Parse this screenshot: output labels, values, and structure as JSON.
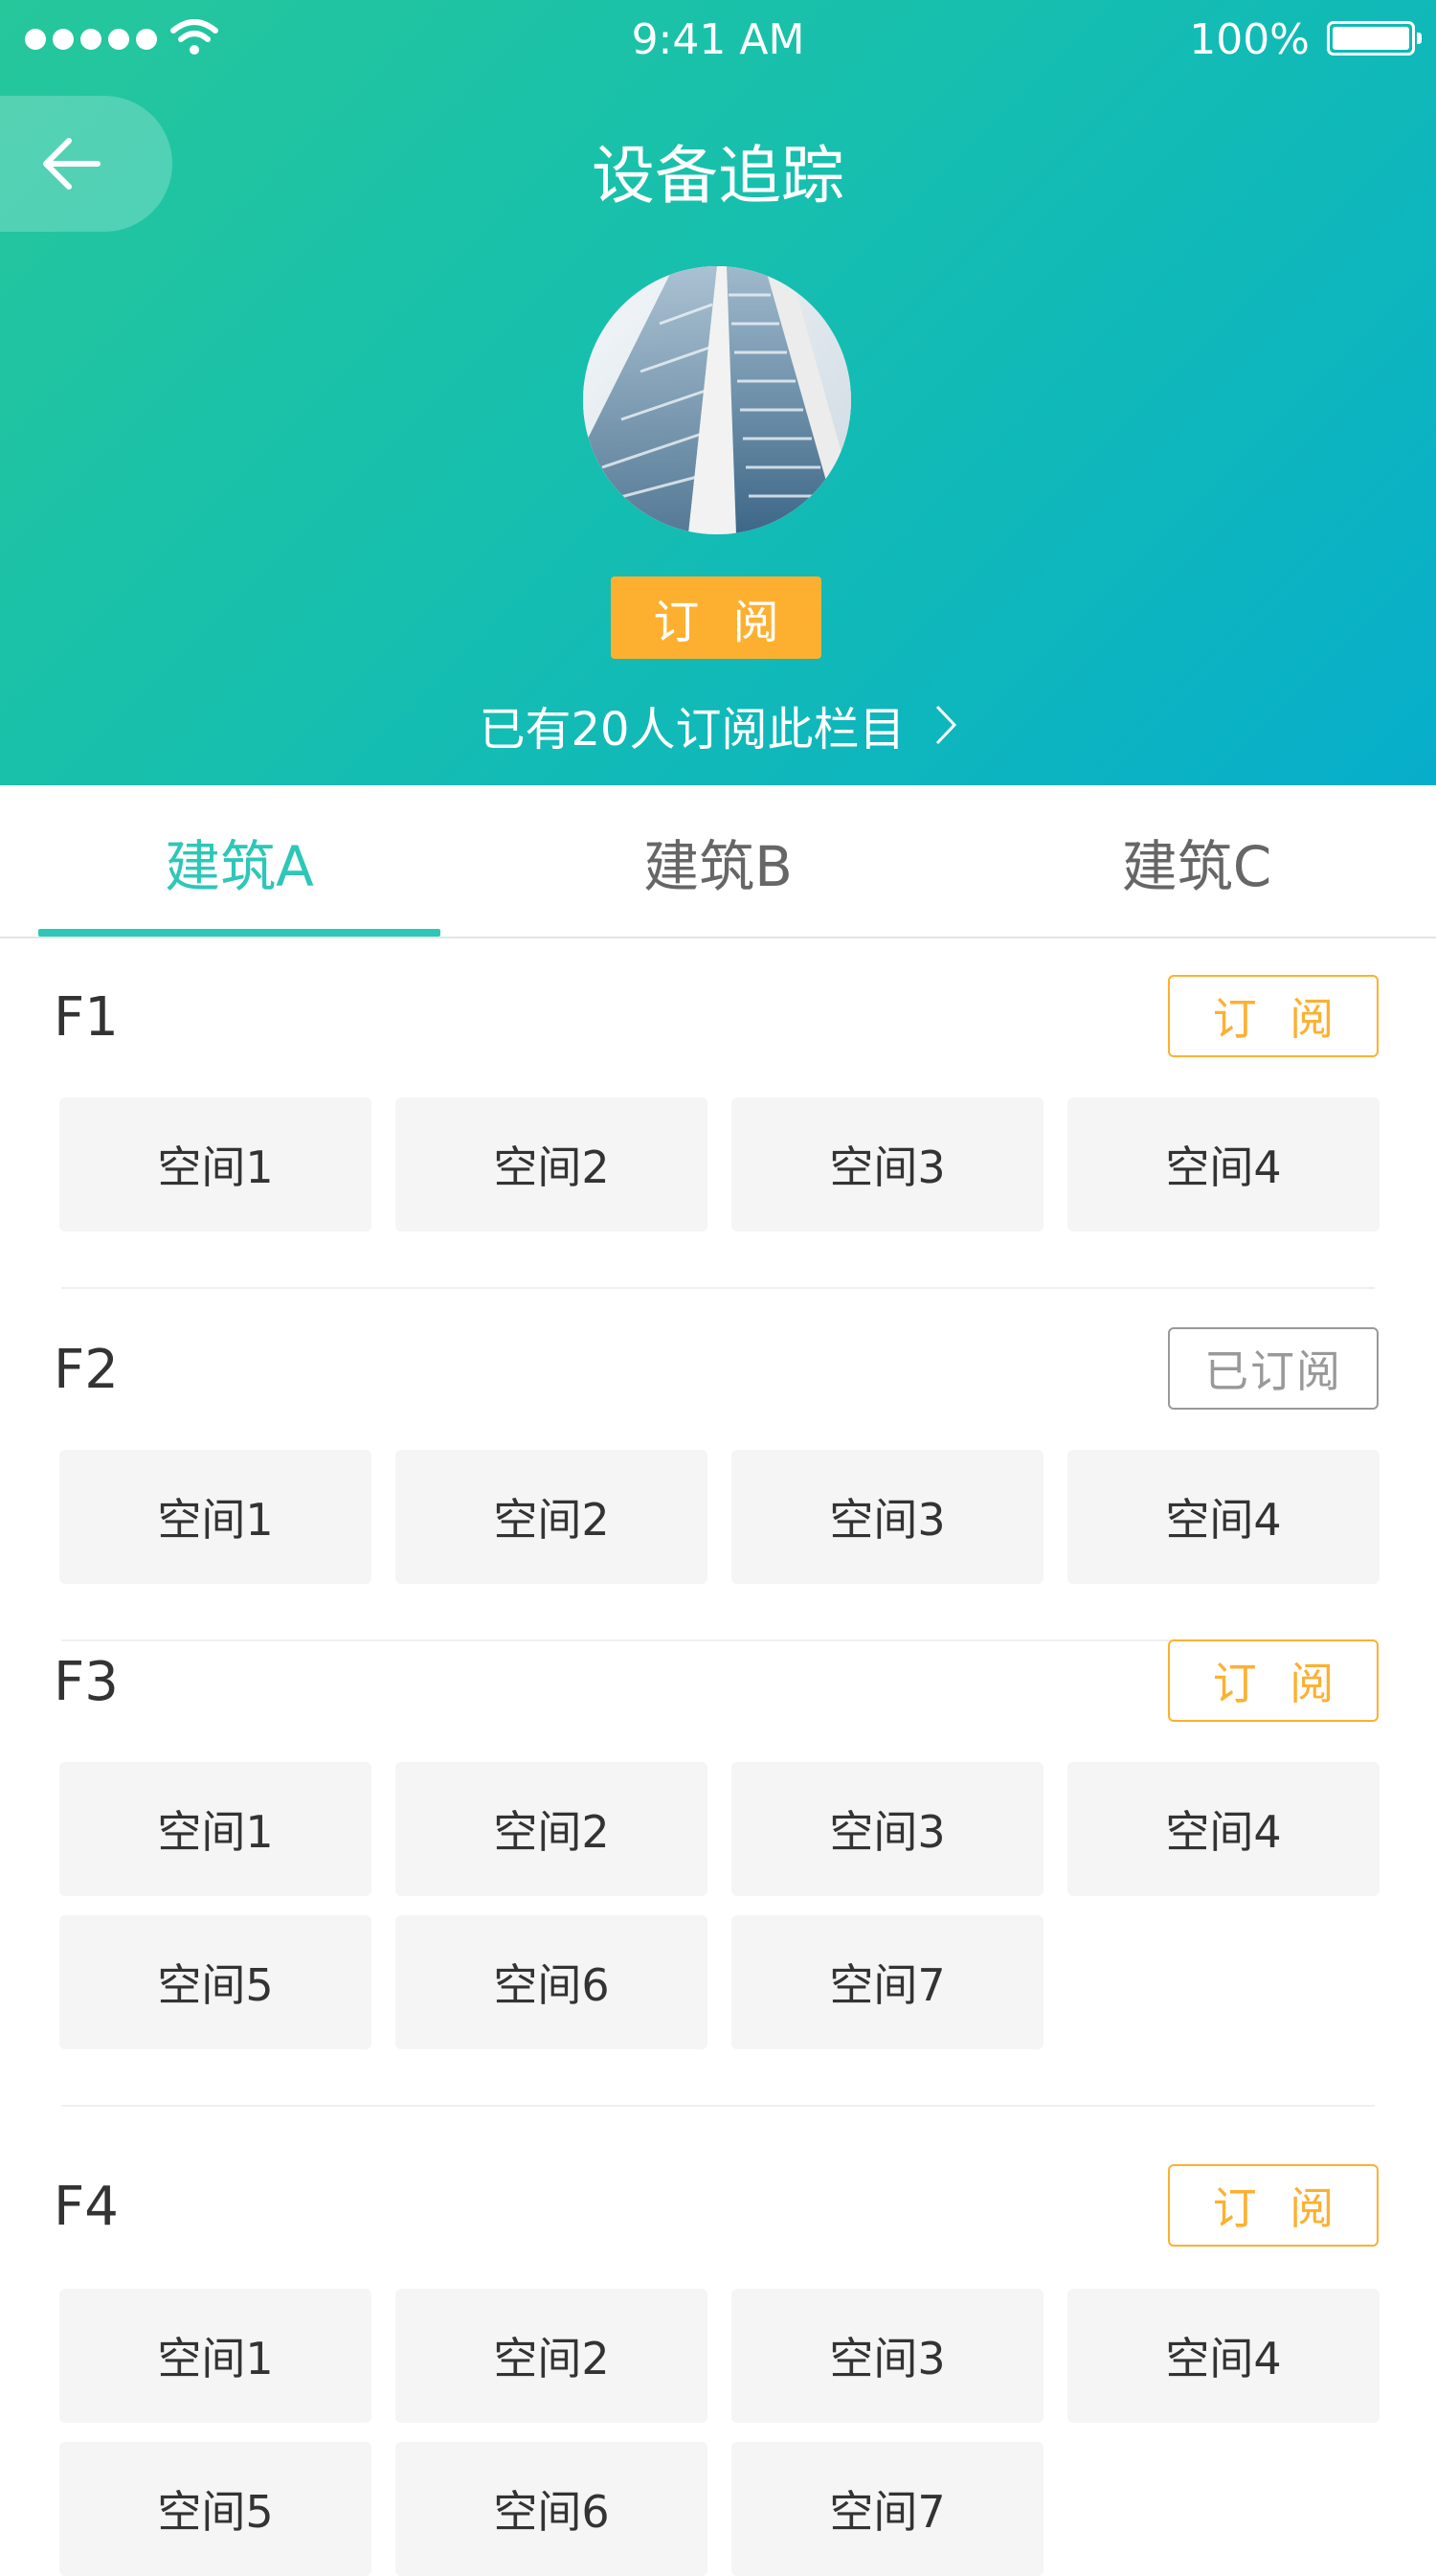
{
  "status_bar": {
    "time": "9:41 AM",
    "battery": "100%"
  },
  "header": {
    "title": "设备追踪",
    "subscribe_label": "订 阅",
    "subscriber_text": "已有20人订阅此栏目"
  },
  "tabs": [
    {
      "label": "建筑A",
      "active": true
    },
    {
      "label": "建筑B",
      "active": false
    },
    {
      "label": "建筑C",
      "active": false
    }
  ],
  "floors": [
    {
      "name": "F1",
      "button": "订 阅",
      "subscribed": false,
      "rooms": [
        "空间1",
        "空间2",
        "空间3",
        "空间4"
      ]
    },
    {
      "name": "F2",
      "button": "已订阅",
      "subscribed": true,
      "rooms": [
        "空间1",
        "空间2",
        "空间3",
        "空间4"
      ]
    },
    {
      "name": "F3",
      "button": "订 阅",
      "subscribed": false,
      "rooms": [
        "空间1",
        "空间2",
        "空间3",
        "空间4",
        "空间5",
        "空间6",
        "空间7"
      ]
    },
    {
      "name": "F4",
      "button": "订 阅",
      "subscribed": false,
      "rooms": [
        "空间1",
        "空间2",
        "空间3",
        "空间4",
        "空间5",
        "空间6",
        "空间7"
      ]
    }
  ],
  "colors": {
    "accent": "#2ec7b7",
    "subscribe": "#fdb030",
    "subscribed_gray": "#999999",
    "room_bg": "#f5f5f5"
  },
  "icons": [
    "back-arrow-icon",
    "chevron-right-icon",
    "wifi-icon",
    "battery-icon",
    "signal-icon"
  ]
}
